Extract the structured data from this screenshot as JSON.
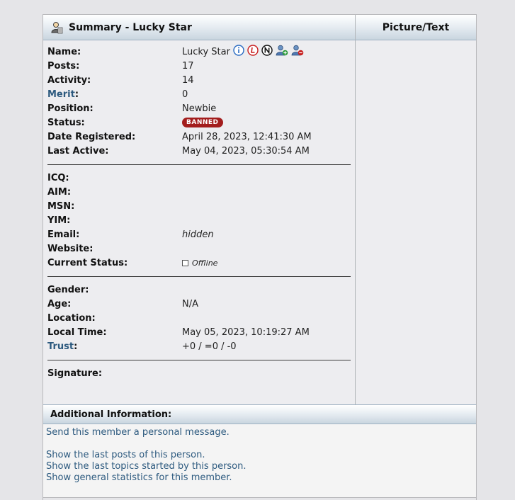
{
  "header": {
    "title": "Summary - Lucky Star",
    "right_title": "Picture/Text"
  },
  "summary": {
    "name_label": "Name:",
    "name_value": "Lucky Star",
    "posts_label": "Posts:",
    "posts_value": "17",
    "activity_label": "Activity:",
    "activity_value": "14",
    "merit_label": "Merit",
    "merit_value": "0",
    "position_label": "Position:",
    "position_value": "Newbie",
    "status_label": "Status:",
    "status_badge": "BANNED",
    "date_registered_label": "Date Registered:",
    "date_registered_value": "April 28, 2023, 12:41:30 AM",
    "last_active_label": "Last Active:",
    "last_active_value": "May 04, 2023, 05:30:54 AM"
  },
  "contact": {
    "icq_label": "ICQ:",
    "aim_label": "AIM:",
    "msn_label": "MSN:",
    "yim_label": "YIM:",
    "email_label": "Email:",
    "email_value": "hidden",
    "website_label": "Website:",
    "current_status_label": "Current Status:",
    "current_status_value": "Offline"
  },
  "personal": {
    "gender_label": "Gender:",
    "age_label": "Age:",
    "age_value": "N/A",
    "location_label": "Location:",
    "local_time_label": "Local Time:",
    "local_time_value": "May 05, 2023, 10:19:27 AM",
    "trust_label": "Trust",
    "trust_value": "+0 / =0 / -0",
    "signature_label": "Signature:"
  },
  "additional": {
    "title": "Additional Information:",
    "send_pm": "Send this member a personal message.",
    "last_posts": "Show the last posts of this person.",
    "last_topics": "Show the last topics started by this person.",
    "general_stats": "Show general statistics for this member."
  },
  "colors": {
    "link": "#2d5a7f",
    "banned_badge": "#a31d1d",
    "background": "#e5e5e8",
    "panel": "#ededf0"
  },
  "icons": [
    "person-icon",
    "info-icon",
    "ledger-icon",
    "n-icon",
    "add-buddy-icon",
    "ignore-user-icon"
  ]
}
